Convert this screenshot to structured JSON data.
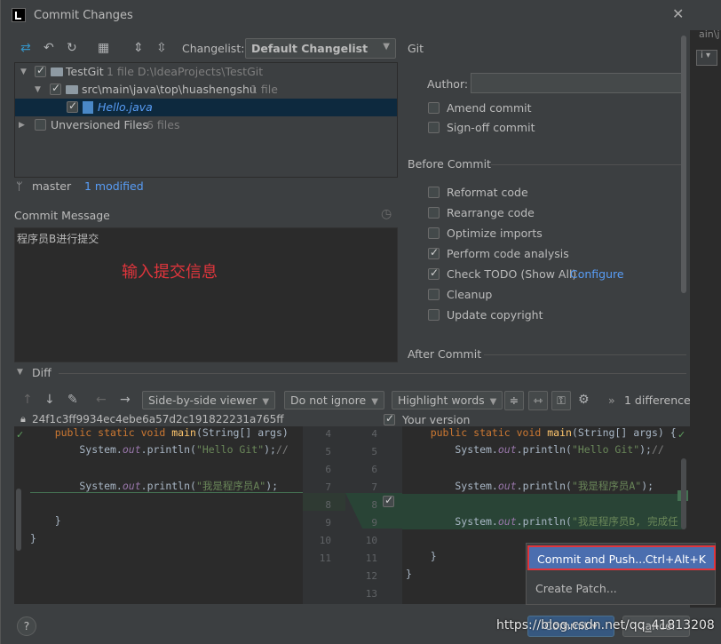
{
  "window": {
    "title": "Commit Changes",
    "close_glyph": "✕",
    "background_hint": "ain\\j",
    "background_box": "i ▾"
  },
  "toolbar": {
    "icons": [
      "move-to-changelist-icon",
      "rollback-icon",
      "refresh-icon",
      "group-by-icon",
      "expand-all-icon",
      "collapse-all-icon"
    ],
    "changelist_label": "Changelist:",
    "changelist_value": "Default Changelist"
  },
  "tree": {
    "root": {
      "name": "TestGit",
      "meta": "1 file  D:\\IdeaProjects\\TestGit"
    },
    "folder": {
      "name": "src\\main\\java\\top\\huashengshu",
      "meta": "1 file"
    },
    "file": {
      "name": "Hello.java"
    },
    "unversioned": {
      "name": "Unversioned Files",
      "meta": "6 files"
    }
  },
  "status": {
    "branch": "master",
    "modified": "1 modified"
  },
  "commit_message": {
    "label": "Commit Message",
    "text": "程序员B进行提交",
    "annotation": "输入提交信息"
  },
  "git_panel": {
    "header": "Git",
    "author_label": "Author:",
    "author_value": "",
    "options": [
      {
        "label": "Amend commit",
        "checked": false
      },
      {
        "label": "Sign-off commit",
        "checked": false
      }
    ]
  },
  "before_commit": {
    "header": "Before Commit",
    "options": [
      {
        "label": "Reformat code",
        "checked": false
      },
      {
        "label": "Rearrange code",
        "checked": false
      },
      {
        "label": "Optimize imports",
        "checked": false
      },
      {
        "label": "Perform code analysis",
        "checked": true
      },
      {
        "label": "Check TODO (Show All)",
        "checked": true,
        "link": "Configure"
      },
      {
        "label": "Cleanup",
        "checked": false
      },
      {
        "label": "Update copyright",
        "checked": false
      }
    ]
  },
  "after_commit": {
    "header": "After Commit"
  },
  "diff": {
    "header": "Diff",
    "viewer": "Side-by-side viewer",
    "ignore": "Do not ignore",
    "highlight": "Highlight words",
    "difference_count": "1 difference",
    "left_revision": "24f1c3ff9934ec4ebe6a57d2c191822231a765ff",
    "right_revision": "Your version",
    "left_lines": [
      "    public static void main(String[] args)",
      "        System.out.println(\"Hello Git\");//",
      "",
      "        System.out.println(\"我是程序员A\");",
      "",
      "    }",
      "}"
    ],
    "right_lines": [
      "    public static void main(String[] args) {",
      "        System.out.println(\"Hello Git\");//",
      "",
      "        System.out.println(\"我是程序员A\");",
      "",
      "        System.out.println(\"我是程序员B, 完成任",
      "",
      "    }",
      "}",
      ""
    ],
    "gutter_left": [
      "4",
      "5",
      "6",
      "7",
      "8",
      "9",
      "10",
      "11"
    ],
    "gutter_right": [
      "4",
      "5",
      "6",
      "7",
      "8",
      "9",
      "10",
      "11",
      "12",
      "13"
    ]
  },
  "popup": {
    "items": [
      {
        "label": "Commit and Push...",
        "shortcut": "Ctrl+Alt+K"
      },
      {
        "label": "Create Patch...",
        "shortcut": ""
      }
    ]
  },
  "footer": {
    "help": "?",
    "commit_button": "Commit",
    "cancel_button": "Cancel",
    "watermark": "https://blog.csdn.net/qq_41813208"
  },
  "colors": {
    "accent": "#4b6eaf",
    "annotation_red": "#e0353c",
    "link": "#589df6"
  }
}
